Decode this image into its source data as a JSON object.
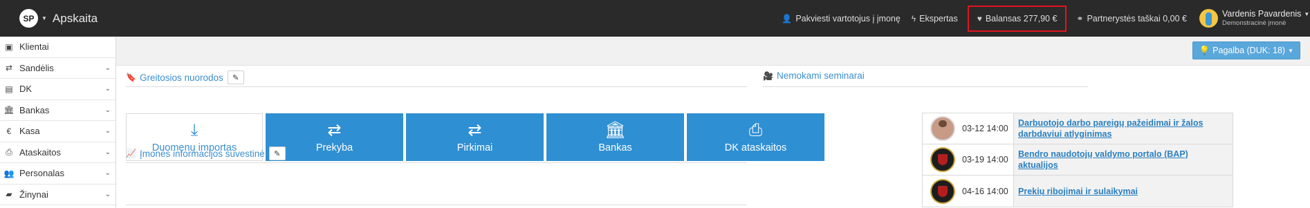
{
  "header": {
    "logo": "SP",
    "app_title": "Apskaita",
    "invite": "Pakviesti vartotojus į įmonę",
    "expert": "Ekspertas",
    "balance": "Balansas 277,90 €",
    "partnership": "Partnerystės taškai 0,00 €",
    "user_name": "Vardenis Pavardenis",
    "user_company": "Demonstracinė įmonė"
  },
  "sidebar": {
    "items": [
      {
        "label": "Klientai",
        "icon": "user-card-icon",
        "expandable": false
      },
      {
        "label": "Sandėlis",
        "icon": "exchange-icon",
        "expandable": true
      },
      {
        "label": "DK",
        "icon": "book-icon",
        "expandable": true
      },
      {
        "label": "Bankas",
        "icon": "bank-icon",
        "expandable": true
      },
      {
        "label": "Kasa",
        "icon": "euro-icon",
        "expandable": true
      },
      {
        "label": "Ataskaitos",
        "icon": "print-icon",
        "expandable": true
      },
      {
        "label": "Personalas",
        "icon": "users-icon",
        "expandable": true
      },
      {
        "label": "Žinynai",
        "icon": "folder-icon",
        "expandable": true
      }
    ]
  },
  "help_button": "Pagalba (DUK: 18)",
  "quick_links": {
    "title": "Greitosios nuorodos",
    "tiles": [
      {
        "label": "Duomenų importas",
        "icon": "download-icon"
      },
      {
        "label": "Prekyba",
        "icon": "exchange-icon"
      },
      {
        "label": "Pirkimai",
        "icon": "exchange-icon"
      },
      {
        "label": "Bankas",
        "icon": "bank-icon"
      },
      {
        "label": "DK ataskaitos",
        "icon": "print-icon"
      }
    ]
  },
  "company_summary": {
    "title": "Įmonės informacijos suvestinė"
  },
  "seminars": {
    "title": "Nemokami seminarai",
    "rows": [
      {
        "date": "03-12 14:00",
        "title": "Darbuotojo darbo pareigų pažeidimai ir žalos darbdaviui atlyginimas",
        "image": "person"
      },
      {
        "date": "03-19 14:00",
        "title": "Bendro naudotojų valdymo portalo (BAP) aktualijos",
        "image": "emblem"
      },
      {
        "date": "04-16 14:00",
        "title": "Prekių ribojimai ir sulaikymai",
        "image": "emblem"
      }
    ]
  },
  "colors": {
    "accent": "#2f8fd3",
    "highlight_border": "#e0141e",
    "topbar": "#2a2a2a"
  }
}
